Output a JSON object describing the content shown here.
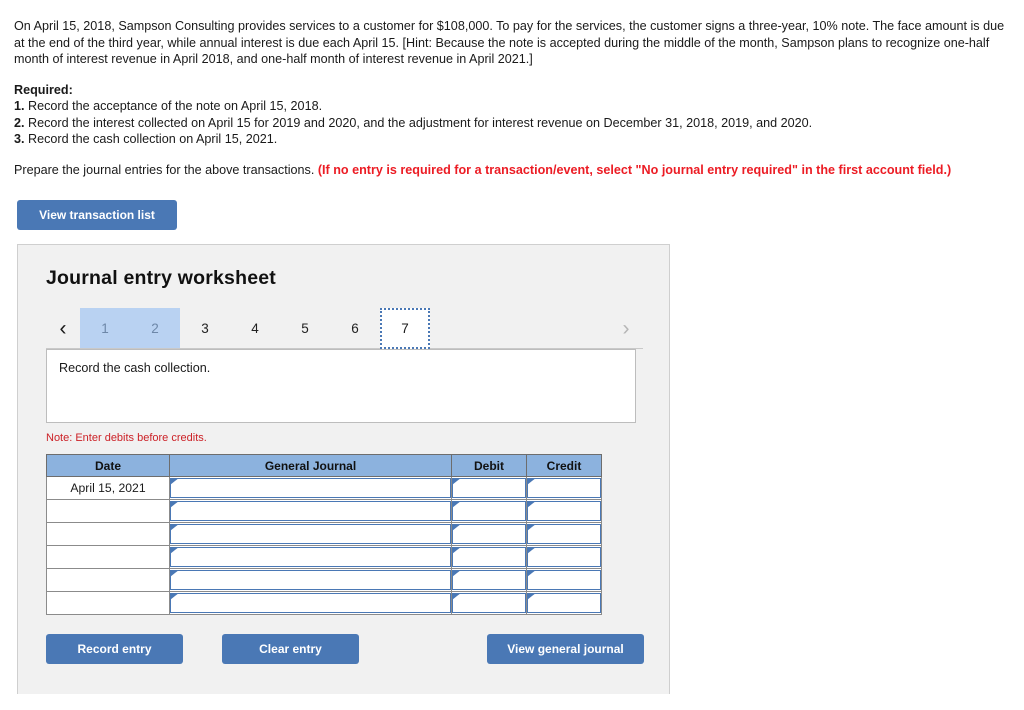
{
  "problem": {
    "paragraph1": "On April 15, 2018, Sampson Consulting provides services to a customer for $108,000. To pay for the services, the customer signs a three-year, 10% note. The face amount is  due at the end of the third year, while annual interest is due each April 15. [Hint: Because the note is accepted during the middle of the month, Sampson plans to recognize one-half month of interest revenue in April 2018, and one-half month of interest revenue in April 2021.]",
    "required_label": "Required:",
    "requirements": [
      {
        "number": "1.",
        "text": " Record the acceptance of the note on April 15, 2018."
      },
      {
        "number": "2.",
        "text": " Record the interest collected on April 15 for 2019 and 2020, and the adjustment for interest revenue on December 31, 2018, 2019, and 2020."
      },
      {
        "number": "3.",
        "text": " Record the cash collection on April 15, 2021."
      }
    ],
    "instruction_plain": "Prepare the journal entries for the above transactions. ",
    "instruction_red": "(If no entry is required for a transaction/event, select \"No journal entry required\" in the first account field.)"
  },
  "toolbar": {
    "view_transaction_list_label": "View transaction list"
  },
  "worksheet": {
    "title": "Journal entry worksheet",
    "prev_arrow": "‹",
    "next_arrow": "›",
    "tabs": [
      {
        "label": "1",
        "state": "done"
      },
      {
        "label": "2",
        "state": "done"
      },
      {
        "label": "3",
        "state": "normal"
      },
      {
        "label": "4",
        "state": "normal"
      },
      {
        "label": "5",
        "state": "normal"
      },
      {
        "label": "6",
        "state": "normal"
      },
      {
        "label": "7",
        "state": "active"
      }
    ],
    "prompt": "Record the cash collection.",
    "note": "Note: Enter debits before credits.",
    "table": {
      "headers": [
        "Date",
        "General Journal",
        "Debit",
        "Credit"
      ],
      "rows": [
        {
          "date": "April 15, 2021",
          "general_journal": "",
          "debit": "",
          "credit": ""
        },
        {
          "date": "",
          "general_journal": "",
          "debit": "",
          "credit": ""
        },
        {
          "date": "",
          "general_journal": "",
          "debit": "",
          "credit": ""
        },
        {
          "date": "",
          "general_journal": "",
          "debit": "",
          "credit": ""
        },
        {
          "date": "",
          "general_journal": "",
          "debit": "",
          "credit": ""
        },
        {
          "date": "",
          "general_journal": "",
          "debit": "",
          "credit": ""
        }
      ]
    },
    "buttons": {
      "record_entry": "Record entry",
      "clear_entry": "Clear entry",
      "view_general_journal": "View general journal"
    }
  },
  "colors": {
    "button_blue": "#4a78b5",
    "header_blue": "#8cb2de",
    "tab_done_blue": "#b9d2f2",
    "alert_red": "#ec1c24",
    "note_red": "#cc2127",
    "panel_gray": "#f1f1f1"
  }
}
